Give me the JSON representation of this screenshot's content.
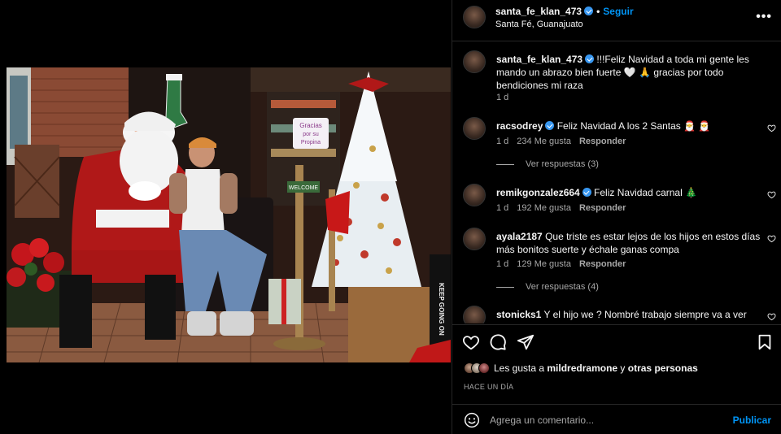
{
  "header": {
    "username": "santa_fe_klan_473",
    "separator": "•",
    "follow_label": "Seguir",
    "location": "Santa Fé, Guanajuato",
    "more_label": "•••"
  },
  "caption": {
    "username": "santa_fe_klan_473",
    "text": " !!!Feliz Navidad a toda mi gente les mando un abrazo bien fuerte 🤍 🙏 gracias por todo bendiciones mi raza",
    "time": "1 d"
  },
  "comments": [
    {
      "username": "racsodrey",
      "verified": true,
      "text": " Feliz Navidad A los 2 Santas 🎅 🎅",
      "time": "1 d",
      "likes": "234 Me gusta",
      "reply_label": "Responder",
      "view_replies": "Ver respuestas (3)"
    },
    {
      "username": "remikgonzalez664",
      "verified": true,
      "text": " Feliz Navidad carnal 🎄",
      "time": "1 d",
      "likes": "192 Me gusta",
      "reply_label": "Responder"
    },
    {
      "username": "ayala2187",
      "verified": false,
      "text": " Que triste es estar lejos de los hijos en estos días más bonitos suerte y échale ganas compa",
      "time": "1 d",
      "likes": "129 Me gusta",
      "reply_label": "Responder",
      "view_replies": "Ver respuestas (4)"
    },
    {
      "username": "stonicks1",
      "verified": false,
      "text": " Y el hijo we ? Nombré trabajo siempre va a ver"
    }
  ],
  "likes_summary": {
    "prefix": "Les gusta a ",
    "user": "mildredramone",
    "middle": " y ",
    "others": "otras personas"
  },
  "time_ago": "HACE UN DÍA",
  "composer": {
    "placeholder": "Agrega un comentario...",
    "publish_label": "Publicar"
  },
  "photo": {
    "sign_text_1": "Gracias",
    "sign_text_2": "por su",
    "sign_text_3": "Propina",
    "welcome_text": "WELCOME",
    "banner_text": "KEEP GOING ON"
  },
  "colors": {
    "accent": "#0095f6",
    "verified": "#3897f0",
    "background": "#000000",
    "muted": "#a8a8a8"
  }
}
